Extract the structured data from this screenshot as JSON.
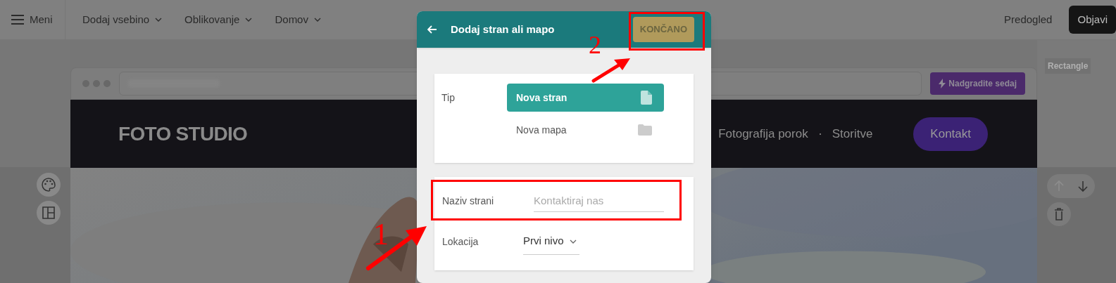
{
  "top_bar": {
    "menu": "Meni",
    "menus": [
      {
        "label": "Dodaj vsebino"
      },
      {
        "label": "Oblikovanje"
      },
      {
        "label": "Domov"
      }
    ],
    "preview": "Predogled",
    "publish": "Objavi"
  },
  "editor": {
    "tag": "Rectangle",
    "upgrade": "Nadgradite sedaj",
    "site": {
      "logo": "FOTO STUDIO",
      "nav": [
        "Fotografija porok",
        "Storitve"
      ],
      "cta": "Kontakt"
    },
    "section_controls": [
      {
        "kind": "up",
        "disabled": true
      },
      {
        "kind": "down",
        "disabled": false
      },
      {
        "kind": "delete",
        "disabled": false
      }
    ]
  },
  "dialog": {
    "title": "Dodaj stran ali mapo",
    "done": "KONČANO",
    "type_label": "Tip",
    "types": [
      {
        "label": "Nova stran",
        "kind": "page",
        "selected": true
      },
      {
        "label": "Nova mapa",
        "kind": "folder",
        "selected": false
      }
    ],
    "name_label": "Naziv strani",
    "name_placeholder": "Kontaktiraj nas",
    "location_label": "Lokacija",
    "location_value": "Prvi nivo"
  },
  "annotations": [
    {
      "label": "2",
      "kind": "upper"
    },
    {
      "label": "1",
      "kind": "lower"
    }
  ]
}
